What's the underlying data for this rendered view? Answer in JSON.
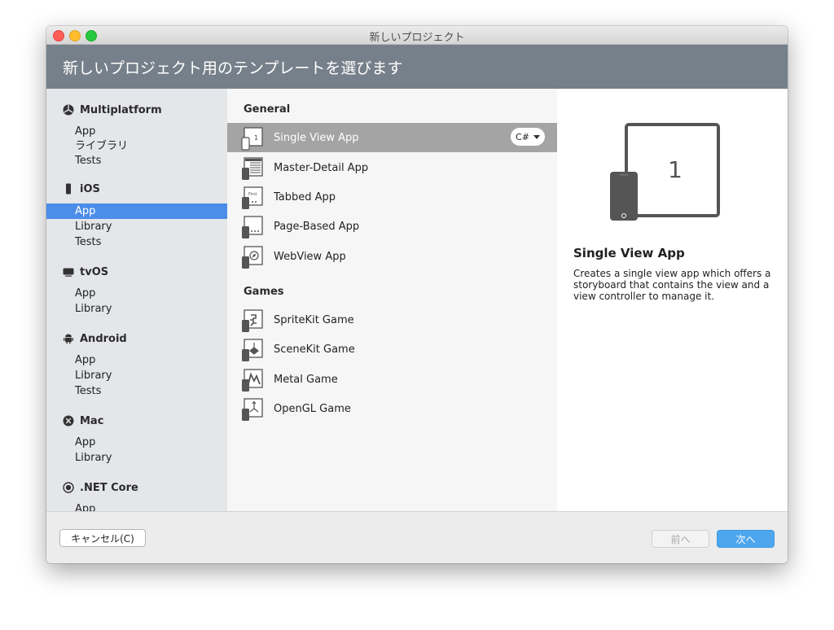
{
  "window": {
    "title": "新しいプロジェクト"
  },
  "header": {
    "title": "新しいプロジェクト用のテンプレートを選びます"
  },
  "sidebar": {
    "categories": [
      {
        "label": "Multiplatform",
        "icon": "multiplatform-icon",
        "items": [
          "App",
          "ライブラリ",
          "Tests"
        ]
      },
      {
        "label": "iOS",
        "icon": "iphone-icon",
        "items": [
          "App",
          "Library",
          "Tests"
        ],
        "selected": "App"
      },
      {
        "label": "tvOS",
        "icon": "tv-icon",
        "items": [
          "App",
          "Library"
        ]
      },
      {
        "label": "Android",
        "icon": "android-icon",
        "items": [
          "App",
          "Library",
          "Tests"
        ]
      },
      {
        "label": "Mac",
        "icon": "mac-icon",
        "items": [
          "App",
          "Library"
        ]
      },
      {
        "label": ".NET Core",
        "icon": "dotnet-icon",
        "items": [
          "App"
        ]
      }
    ]
  },
  "templates": {
    "general_heading": "General",
    "general": [
      "Single View App",
      "Master-Detail App",
      "Tabbed App",
      "Page-Based App",
      "WebView App"
    ],
    "games_heading": "Games",
    "games": [
      "SpriteKit Game",
      "SceneKit Game",
      "Metal Game",
      "OpenGL Game"
    ],
    "selected": "Single View App",
    "language": "C#"
  },
  "preview": {
    "title": "Single View App",
    "description": "Creates a single view app which offers a storyboard that contains the view and a view controller to manage it.",
    "tablet_label": "1",
    "small_icon_label": "1"
  },
  "footer": {
    "cancel_label": "キャンセル(C)",
    "prev_label": "前へ",
    "next_label": "次へ"
  },
  "colors": {
    "header_bg": "#76808a",
    "selection_blue": "#4b8de8",
    "selection_gray": "#a4a4a4",
    "next_button": "#4ea7ee"
  }
}
